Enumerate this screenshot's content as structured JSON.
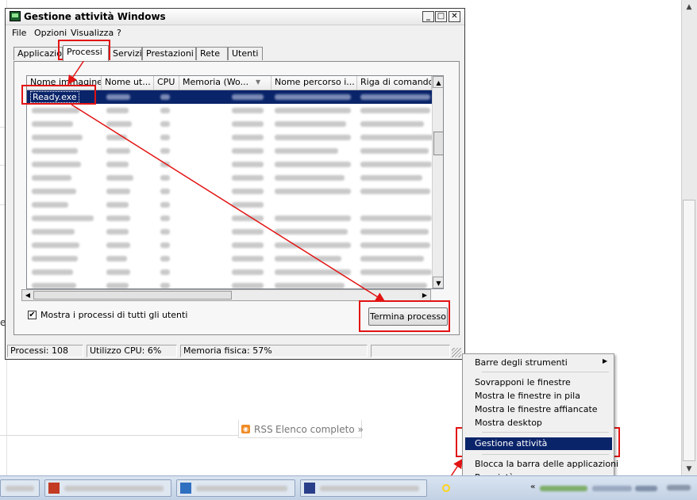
{
  "window": {
    "title": "Gestione attività Windows",
    "menus": [
      "File",
      "Opzioni",
      "Visualizza",
      "?"
    ],
    "tabs": [
      "Applicazioni",
      "Processi",
      "Servizi",
      "Prestazioni",
      "Rete",
      "Utenti"
    ],
    "active_tab": "Processi",
    "columns": [
      "Nome immagine",
      "Nome ut...",
      "CPU",
      "Memoria (Wo...",
      "Nome percorso i...",
      "Riga di comando"
    ],
    "selected_process": "Ready.exe",
    "show_all_label": "Mostra i processi di tutti gli utenti",
    "show_all_checked": true,
    "end_process_label": "Termina processo",
    "status": {
      "processes": "Processi: 108",
      "cpu": "Utilizzo CPU: 6%",
      "memory": "Memoria fisica: 57%"
    }
  },
  "context_menu": {
    "items": [
      "Barre degli strumenti",
      "Sovrapponi le finestre",
      "Mostra le finestre in pila",
      "Mostra le finestre affiancate",
      "Mostra desktop",
      "Gestione attività",
      "Blocca la barra delle applicazioni",
      "Proprietà"
    ],
    "highlighted": "Gestione attività"
  },
  "background": {
    "rss_label": "RSS",
    "list_link": "Elenco completo »",
    "stray_char": "e"
  },
  "colors": {
    "annotation": "#e21313",
    "selection": "#0a246a",
    "pointer": "#ffd21c"
  }
}
